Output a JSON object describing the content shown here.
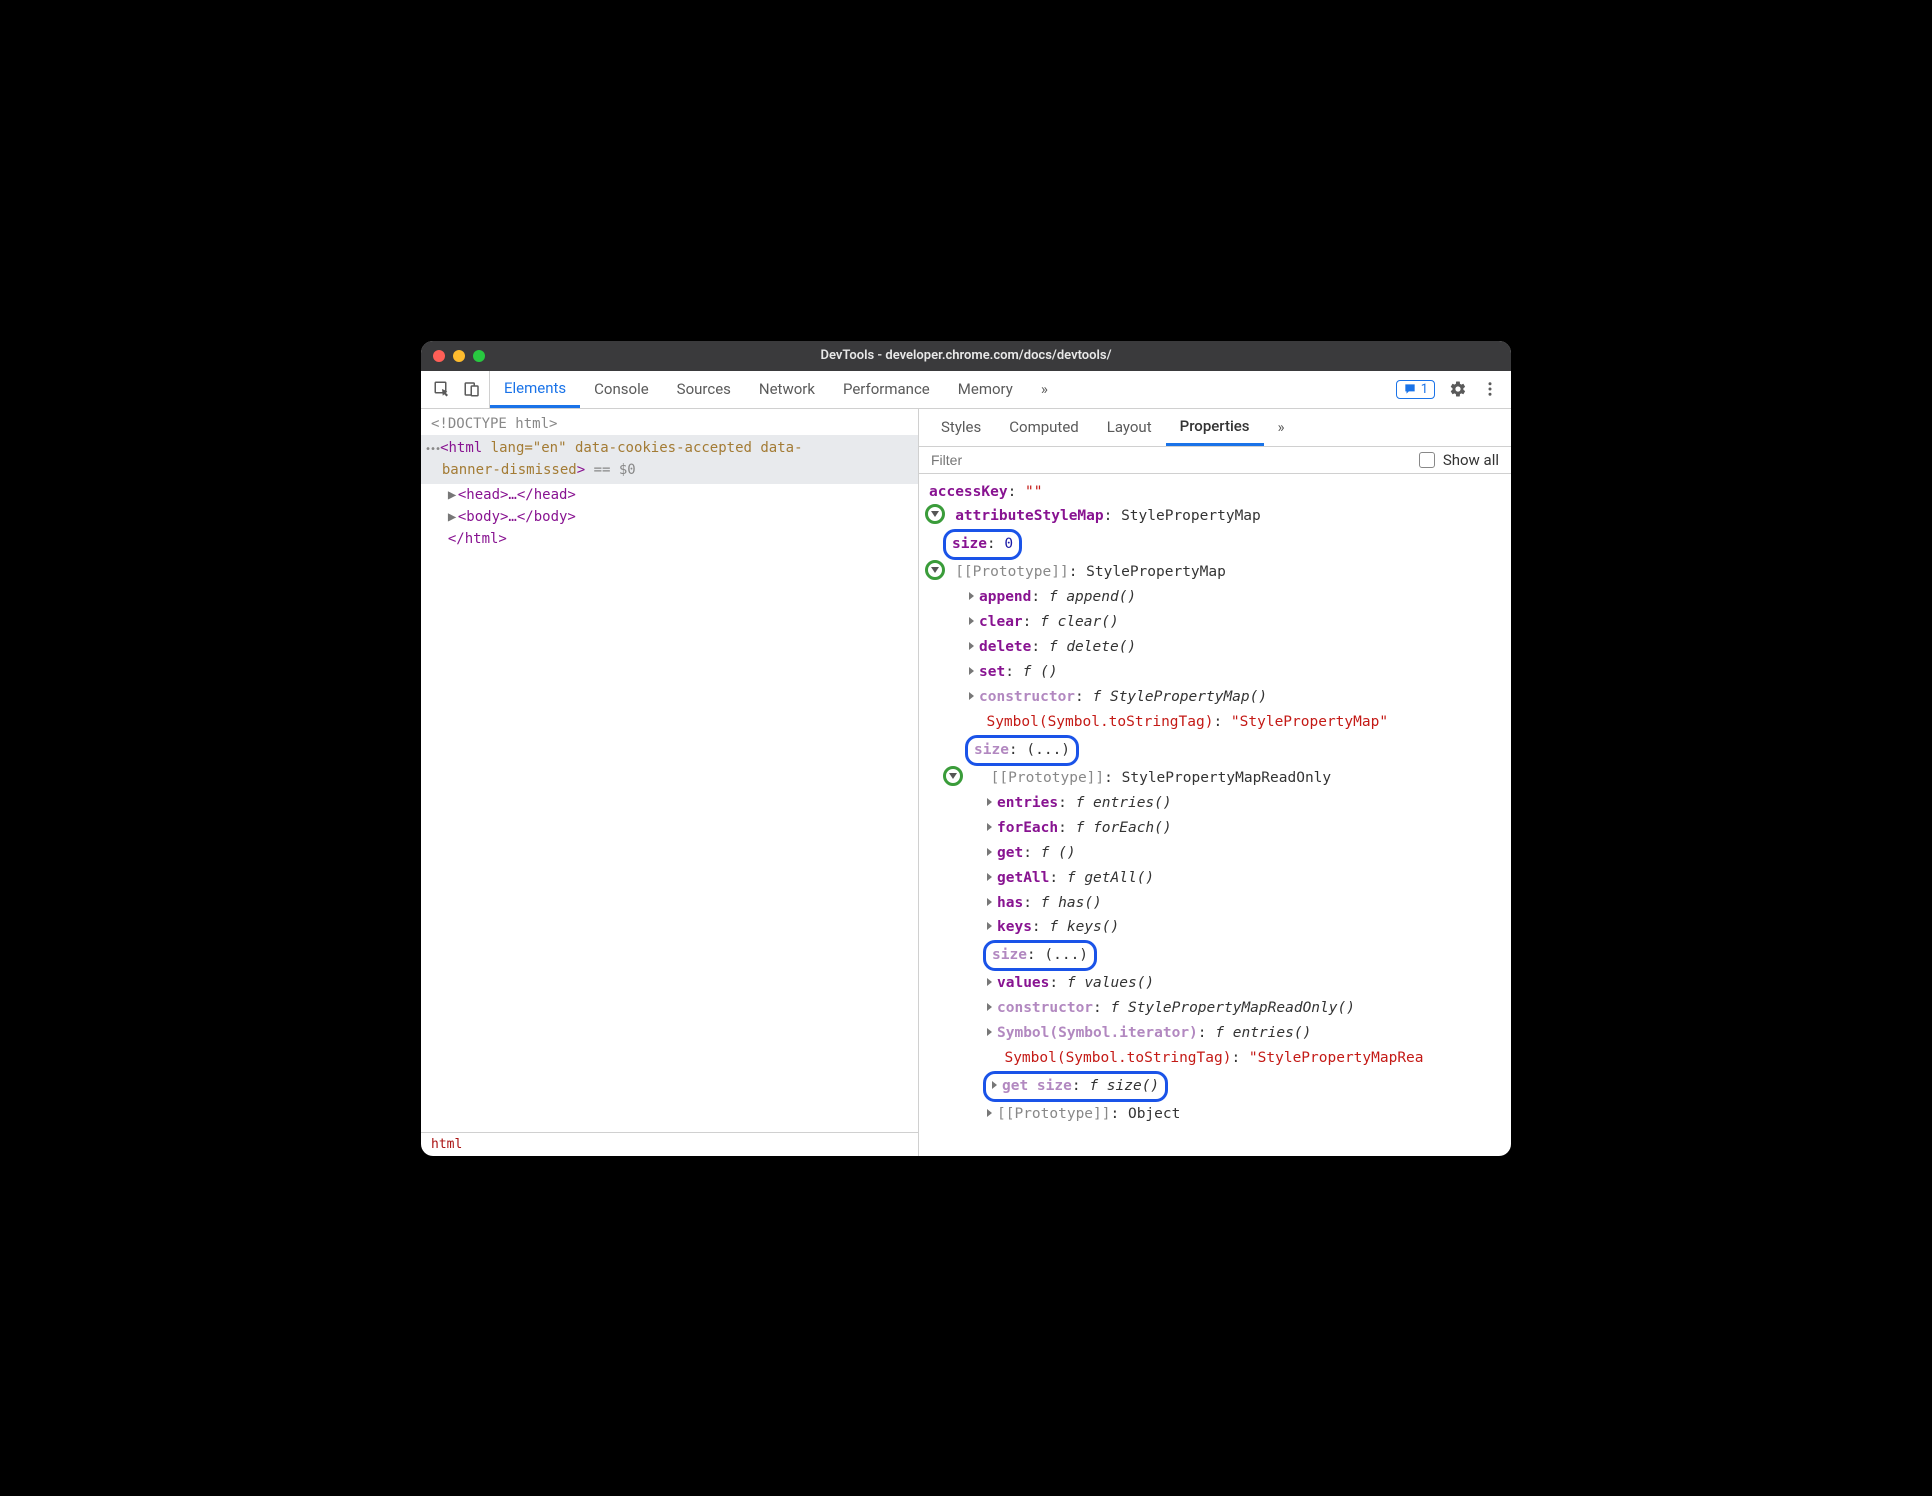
{
  "window": {
    "title": "DevTools - developer.chrome.com/docs/devtools/"
  },
  "toolbar": {
    "tabs": [
      "Elements",
      "Console",
      "Sources",
      "Network",
      "Performance",
      "Memory"
    ],
    "active_tab": "Elements",
    "more_glyph": "»",
    "issues_count": "1"
  },
  "dom": {
    "doctype": "<!DOCTYPE html>",
    "html_open_1": "html",
    "html_attrs": "lang=\"en\" data-cookies-accepted data-",
    "html_open_2": "banner-dismissed",
    "eq0": "== $0",
    "head": "<head>…</head>",
    "body": "<body>…</body>",
    "html_close": "</html>",
    "breadcrumb": "html"
  },
  "side": {
    "tabs": [
      "Styles",
      "Computed",
      "Layout",
      "Properties"
    ],
    "active": "Properties",
    "more_glyph": "»",
    "filter_placeholder": "Filter",
    "show_all": "Show all"
  },
  "props": {
    "accessKey": {
      "name": "accessKey",
      "value": "\"\""
    },
    "attributeStyleMap": {
      "name": "attributeStyleMap",
      "value": "StylePropertyMap"
    },
    "size0": {
      "name": "size",
      "value": "0"
    },
    "proto1": {
      "label": "[[Prototype]]",
      "value": "StylePropertyMap"
    },
    "append": {
      "name": "append",
      "fn": "append()"
    },
    "clear": {
      "name": "clear",
      "fn": "clear()"
    },
    "delete": {
      "name": "delete",
      "fn": "delete()"
    },
    "set": {
      "name": "set",
      "fn": "()"
    },
    "constructor1": {
      "name": "constructor",
      "fn": "StylePropertyMap()"
    },
    "symbolTag1": {
      "name": "Symbol(Symbol.toStringTag)",
      "value": "\"StylePropertyMap\""
    },
    "sizeEllipsis1": {
      "name": "size",
      "value": "(...)"
    },
    "proto2": {
      "label": "[[Prototype]]",
      "value": "StylePropertyMapReadOnly"
    },
    "entries": {
      "name": "entries",
      "fn": "entries()"
    },
    "forEach": {
      "name": "forEach",
      "fn": "forEach()"
    },
    "get": {
      "name": "get",
      "fn": "()"
    },
    "getAll": {
      "name": "getAll",
      "fn": "getAll()"
    },
    "has": {
      "name": "has",
      "fn": "has()"
    },
    "keys": {
      "name": "keys",
      "fn": "keys()"
    },
    "sizeEllipsis2": {
      "name": "size",
      "value": "(...)"
    },
    "values": {
      "name": "values",
      "fn": "values()"
    },
    "constructor2": {
      "name": "constructor",
      "fn": "StylePropertyMapReadOnly()"
    },
    "symbolIter": {
      "name": "Symbol(Symbol.iterator)",
      "fn": "entries()"
    },
    "symbolTag2": {
      "name": "Symbol(Symbol.toStringTag)",
      "value": "\"StylePropertyMapRea"
    },
    "getSize": {
      "name": "get size",
      "fn": "size()"
    },
    "proto3": {
      "label": "[[Prototype]]",
      "value": "Object"
    }
  }
}
